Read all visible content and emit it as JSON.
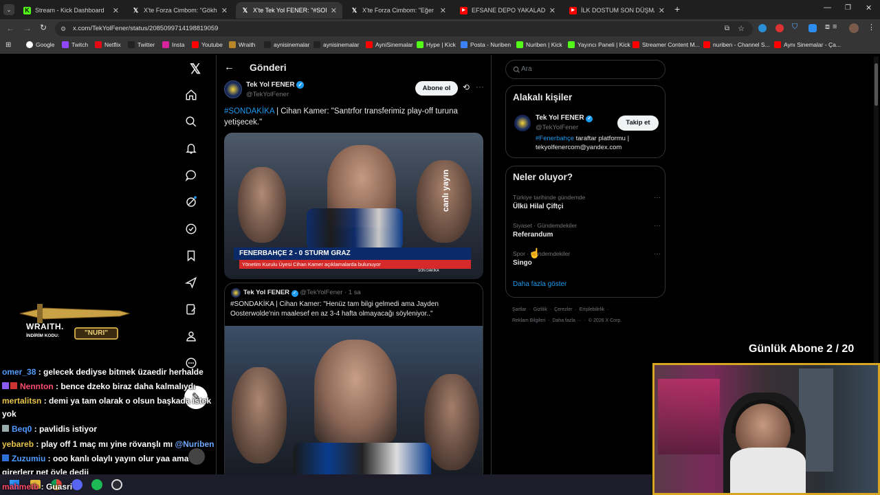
{
  "browser": {
    "tabs": [
      {
        "title": "Stream - Kick Dashboard",
        "icon": "kick-icon"
      },
      {
        "title": "X'te Forza Cimbom: \"Gökhan D",
        "icon": "x-icon"
      },
      {
        "title": "X'te Tek Yol FENER: \"#SOND",
        "icon": "x-icon"
      },
      {
        "title": "X'te Forza Cimbom: \"Eğer hiç b",
        "icon": "x-icon"
      },
      {
        "title": "EFSANE DEPO YAKALADIK / STE",
        "icon": "youtube-icon"
      },
      {
        "title": "İLK DOSTUM SON DÜŞMANIM",
        "icon": "youtube-icon"
      }
    ],
    "url": "x.com/TekYolFener/status/2085099714198819059",
    "bookmarks": [
      "Google",
      "Twitch",
      "Netflix",
      "Twitter",
      "Insta",
      "Youtube",
      "Wraith",
      "aynisinemalar",
      "aynisinemalar",
      "AyniSinemalar",
      "Hype | Kick",
      "Posta - Nuriben",
      "Nuriben | Kick",
      "Yayıncı Paneli | Kick",
      "Streamer Content M...",
      "nuriben - Channel S...",
      "Aynı Sinemalar - Ça..."
    ]
  },
  "header": {
    "title": "Gönderi"
  },
  "post": {
    "author": "Tek Yol FENER",
    "handle": "@TekYolFener",
    "subscribe_label": "Abone ol",
    "hashtag": "#SONDAKİKA",
    "text": " | Cihan Kamer: \"Santrfor transferimiz play-off turuna yetişecek.\"",
    "image1": {
      "banner": "FENERBAHÇE 2 - 0 STURM GRAZ",
      "caption": "Yönetim Kurulu Üyesi Cihan Kamer açıklamalarda bulunuyor",
      "watermark": "canlı yayın",
      "tag": "SON DAKİKA"
    },
    "quoted": {
      "author": "Tek Yol FENER",
      "handle": "@TekYolFener",
      "time": "· 1 sa",
      "text": "#SONDAKİKA | Cihan Kamer: \"Henüz tam bilgi gelmedi ama Jayden Oosterwolde'nin maalesef en az 3-4 hafta olmayacağı söyleniyor..\""
    }
  },
  "sidebar": {
    "search_placeholder": "Ara",
    "related_title": "Alakalı kişiler",
    "related": {
      "name": "Tek Yol FENER",
      "handle": "@TekYolFener",
      "follow_label": "Takip et",
      "bio_tag": "#Fenerbahçe",
      "bio_rest": " taraftar platformu |",
      "bio_line2": "tekyolfenercom@yandex.com"
    },
    "trends_title": "Neler oluyor?",
    "trends": [
      {
        "context": "Türkiye tarihinde gündemde",
        "name": "Ülkü Hilal Çiftçi"
      },
      {
        "context": "Siyaset · Gündemdekiler",
        "name": "Referandum"
      },
      {
        "context": "Spor · Gündemdekiler",
        "name": "Singo"
      }
    ],
    "show_more": "Daha fazla göster",
    "footer1": [
      "Şartlar",
      "Gizlilik",
      "Çerezler",
      "Erişilebilirlik"
    ],
    "footer2": [
      "Reklam Bilgileri",
      "Daha fazla ···",
      "© 2026 X Corp."
    ]
  },
  "overlay": {
    "sub_counter": "Günlük Abone 2 / 20",
    "sponsor_brand": "WRAITH.",
    "sponsor_code_label": "İNDİRİM KODU:",
    "sponsor_code": "\"NURI\"",
    "chat": [
      {
        "user": "omer_38",
        "color": "#4f9bff",
        "msg": " : gelecek dediyse bitmek üzaedir herhalde"
      },
      {
        "user": "Nennton",
        "color": "#ff4d6d",
        "msg": " : bence dzeko biraz daha kalmalıydı"
      },
      {
        "user": "mertalitsn",
        "color": "#e8c34a",
        "msg": " : demi ya tam olarak o olsun başkada istek"
      },
      {
        "user": "",
        "color": "#fff",
        "msg": "yok"
      },
      {
        "user": "Beq0",
        "color": "#4f9bff",
        "msg": " : pavlidis istiyor"
      },
      {
        "user": "yebareb",
        "color": "#e8c34a",
        "msg": " : play off 1 maç mı yine rövanşlı mı "
      },
      {
        "user": "Zuzumiu",
        "color": "#4f9bff",
        "msg": " : ooo kanlı olaylı yayın olur yaa ama"
      },
      {
        "user": "",
        "color": "#fff",
        "msg": "girerlerr net öyle dedii"
      },
      {
        "user": "mahmetb",
        "color": "#ff4d6d",
        "msg": " : Guasri"
      }
    ],
    "mention": "@Nuriben"
  }
}
